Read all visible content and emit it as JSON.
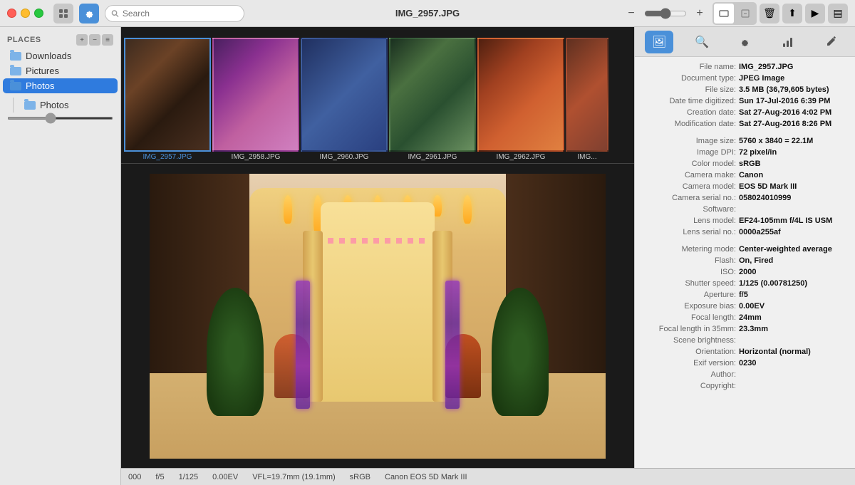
{
  "window": {
    "title": "IMG_2957.JPG"
  },
  "titlebar": {
    "search_placeholder": "Search",
    "zoom_minus": "−",
    "zoom_plus": "+",
    "trash_icon": "🗑",
    "export_icon": "⬆",
    "play_icon": "▶",
    "sidebar_icon": "▤"
  },
  "sidebar": {
    "header": "Places",
    "add_label": "+",
    "remove_label": "−",
    "options_label": "≡",
    "items": [
      {
        "label": "Downloads",
        "selected": false,
        "indent": 0
      },
      {
        "label": "Pictures",
        "selected": false,
        "indent": 0
      },
      {
        "label": "Photos",
        "selected": true,
        "indent": 0
      },
      {
        "label": "Photos",
        "selected": false,
        "indent": 1
      }
    ]
  },
  "filmstrip": {
    "items": [
      {
        "label": "IMG_2957.JPG",
        "selected": true
      },
      {
        "label": "IMG_2958.JPG",
        "selected": false
      },
      {
        "label": "IMG_2960.JPG",
        "selected": false
      },
      {
        "label": "IMG_2961.JPG",
        "selected": false
      },
      {
        "label": "IMG_2962.JPG",
        "selected": false
      },
      {
        "label": "IMG...",
        "selected": false
      }
    ]
  },
  "statusbar": {
    "aperture": "f/5",
    "shutter": "1/125",
    "ev": "0.00EV",
    "focal": "VFL=19.7mm (19.1mm)",
    "color": "sRGB",
    "camera": "Canon EOS 5D Mark III",
    "left_value": "000"
  },
  "info_panel": {
    "tabs": [
      {
        "label": "🖼",
        "active": true
      },
      {
        "label": "🔍",
        "active": false
      },
      {
        "label": "⚙",
        "active": false
      },
      {
        "label": "📊",
        "active": false
      },
      {
        "label": "✏",
        "active": false
      }
    ],
    "rows": [
      {
        "label": "File name:",
        "value": "IMG_2957.JPG",
        "bold": true
      },
      {
        "label": "Document type:",
        "value": "JPEG Image",
        "bold": true
      },
      {
        "label": "File size:",
        "value": "3.5 MB (36,79,605 bytes)",
        "bold": true
      },
      {
        "label": "Date time digitized:",
        "value": "Sun 17-Jul-2016  6:39 PM",
        "bold": true
      },
      {
        "label": "Creation date:",
        "value": "Sat 27-Aug-2016  4:02 PM",
        "bold": true
      },
      {
        "label": "Modification date:",
        "value": "Sat 27-Aug-2016  8:26 PM",
        "bold": true
      },
      {
        "label": "",
        "value": "",
        "gap": true
      },
      {
        "label": "Image size:",
        "value": "5760 x 3840 = 22.1M",
        "bold": true
      },
      {
        "label": "Image DPI:",
        "value": "72 pixel/in",
        "bold": true
      },
      {
        "label": "Color model:",
        "value": "sRGB",
        "bold": true
      },
      {
        "label": "Camera make:",
        "value": "Canon",
        "bold": true
      },
      {
        "label": "Camera model:",
        "value": "EOS 5D Mark III",
        "bold": true
      },
      {
        "label": "Camera serial no.:",
        "value": "058024010999",
        "bold": true
      },
      {
        "label": "Software:",
        "value": "",
        "bold": false
      },
      {
        "label": "Lens model:",
        "value": "EF24-105mm f/4L IS USM",
        "bold": true
      },
      {
        "label": "Lens serial no.:",
        "value": "0000a255af",
        "bold": true
      },
      {
        "label": "",
        "value": "",
        "gap": true
      },
      {
        "label": "Metering mode:",
        "value": "Center-weighted average",
        "bold": true
      },
      {
        "label": "Flash:",
        "value": "On, Fired",
        "bold": true
      },
      {
        "label": "ISO:",
        "value": "2000",
        "bold": true
      },
      {
        "label": "Shutter speed:",
        "value": "1/125 (0.00781250)",
        "bold": true
      },
      {
        "label": "Aperture:",
        "value": "f/5",
        "bold": true
      },
      {
        "label": "Exposure bias:",
        "value": "0.00EV",
        "bold": true
      },
      {
        "label": "Focal length:",
        "value": "24mm",
        "bold": true
      },
      {
        "label": "Focal length in 35mm:",
        "value": "23.3mm",
        "bold": true
      },
      {
        "label": "Scene brightness:",
        "value": "",
        "bold": false
      },
      {
        "label": "Orientation:",
        "value": "Horizontal (normal)",
        "bold": true
      },
      {
        "label": "Exif version:",
        "value": "0230",
        "bold": true
      },
      {
        "label": "Author:",
        "value": "",
        "bold": false
      },
      {
        "label": "Copyright:",
        "value": "",
        "bold": false
      }
    ]
  }
}
